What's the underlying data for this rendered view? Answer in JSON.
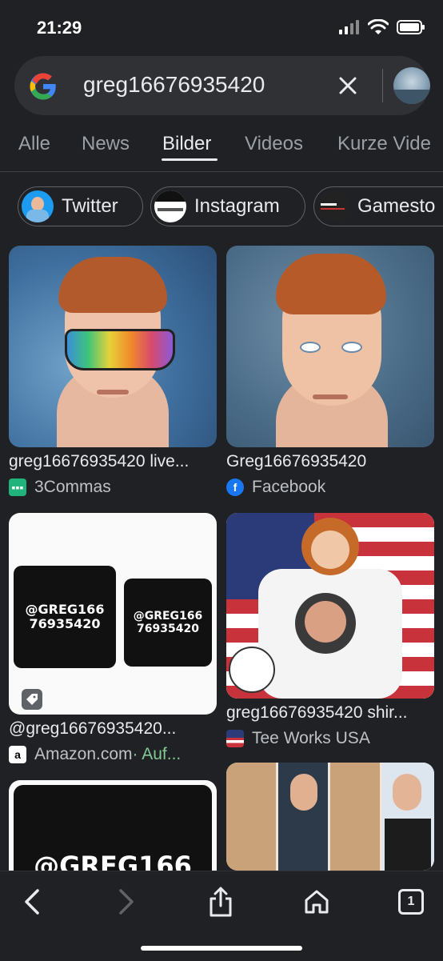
{
  "status": {
    "time": "21:29"
  },
  "search": {
    "query": "greg16676935420"
  },
  "tabs": [
    "Alle",
    "News",
    "Bilder",
    "Videos",
    "Kurze Vide"
  ],
  "chips": [
    "Twitter",
    "Instagram",
    "Gamesto"
  ],
  "results": [
    {
      "title": "greg16676935420 live...",
      "source": "3Commas"
    },
    {
      "title": "Greg16676935420",
      "source": "Facebook"
    },
    {
      "title": "@greg16676935420...",
      "source": "Amazon.com",
      "source_extra": " · Auf..."
    },
    {
      "title": "greg16676935420 shir...",
      "source": "Tee Works USA"
    }
  ],
  "pillow_text": {
    "line1": "@GREG166",
    "line2": "76935420",
    "partial": "@GREG166"
  },
  "tab_count": "1",
  "colors": {
    "accent_green": "#81c995",
    "background": "#202124",
    "surface": "#303134"
  }
}
